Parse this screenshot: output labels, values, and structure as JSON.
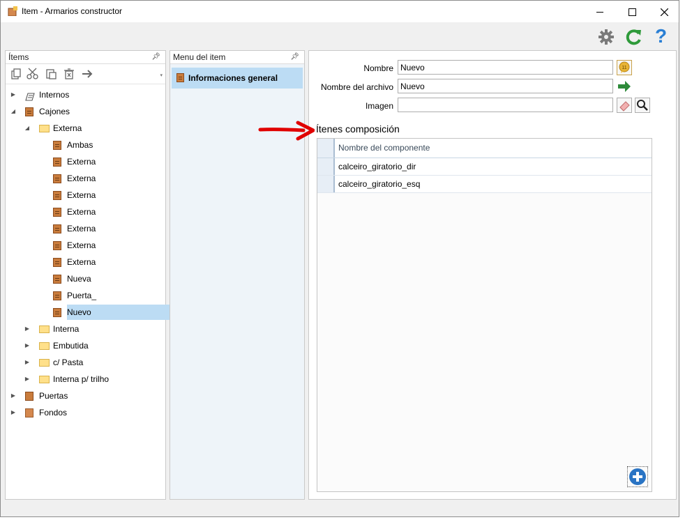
{
  "window": {
    "title": "Item - Armarios constructor"
  },
  "window_controls": {
    "minimize": "—",
    "maximize": "☐",
    "close": "✕"
  },
  "top_toolbar": {
    "settings_icon": "gear-icon",
    "refresh_icon": "refresh-icon",
    "help_label": "?"
  },
  "items_panel": {
    "title": "Ítems",
    "pin": "📌",
    "tools": [
      "copy-icon",
      "cut-icon",
      "paste-icon",
      "delete-icon",
      "move-icon"
    ],
    "tree": [
      {
        "label": "Internos",
        "expander": "▶",
        "icon": "tilted-panel-icon"
      },
      {
        "label": "Cajones",
        "expander": "◢",
        "icon": "drawer-icon"
      },
      {
        "label": "Externa",
        "expander": "◢",
        "icon": "folder-icon"
      },
      {
        "label": "Ambas",
        "expander": "",
        "icon": "drawer-icon"
      },
      {
        "label": "Externa",
        "expander": "",
        "icon": "drawer-icon"
      },
      {
        "label": "Externa",
        "expander": "",
        "icon": "drawer-icon"
      },
      {
        "label": "Externa",
        "expander": "",
        "icon": "drawer-icon"
      },
      {
        "label": "Externa",
        "expander": "",
        "icon": "drawer-icon"
      },
      {
        "label": "Externa",
        "expander": "",
        "icon": "drawer-icon"
      },
      {
        "label": "Externa",
        "expander": "",
        "icon": "drawer-icon"
      },
      {
        "label": "Externa",
        "expander": "",
        "icon": "drawer-icon"
      },
      {
        "label": "Nueva",
        "expander": "",
        "icon": "drawer-icon"
      },
      {
        "label": "Puerta_",
        "expander": "",
        "icon": "drawer-icon"
      },
      {
        "label": "Nuevo",
        "expander": "",
        "icon": "drawer-icon",
        "selected": true
      },
      {
        "label": "Interna",
        "expander": "▶",
        "icon": "folder-icon"
      },
      {
        "label": "Embutida",
        "expander": "▶",
        "icon": "folder-icon"
      },
      {
        "label": "c/ Pasta",
        "expander": "▶",
        "icon": "folder-icon"
      },
      {
        "label": "Interna p/ trilho",
        "expander": "▶",
        "icon": "folder-icon"
      },
      {
        "label": "Puertas",
        "expander": "▶",
        "icon": "door-icon"
      },
      {
        "label": "Fondos",
        "expander": "▶",
        "icon": "panel-icon"
      }
    ]
  },
  "menu_panel": {
    "title": "Menu del item",
    "pin": "📌",
    "items": [
      {
        "label": "Informaciones general",
        "selected": true
      }
    ]
  },
  "form": {
    "nombre_label": "Nombre",
    "nombre_value": "Nuevo",
    "archivo_label": "Nombre del archivo",
    "archivo_value": "Nuevo",
    "imagen_label": "Imagen",
    "imagen_value": "",
    "translate_icon": "speech-bubble-icon",
    "go_icon": "arrow-right-icon",
    "erase_icon": "eraser-icon",
    "search_icon": "magnifier-icon"
  },
  "composition": {
    "heading": "Ítenes composición",
    "column_header": "Nombre del componente",
    "rows": [
      "calceiro_giratorio_dir",
      "calceiro_giratorio_esq"
    ],
    "add_label": "+"
  },
  "colors": {
    "selection": "#bcdcf4",
    "annotation_arrow": "#e00000",
    "refresh": "#2e9a3a",
    "help": "#2a7fd4"
  }
}
